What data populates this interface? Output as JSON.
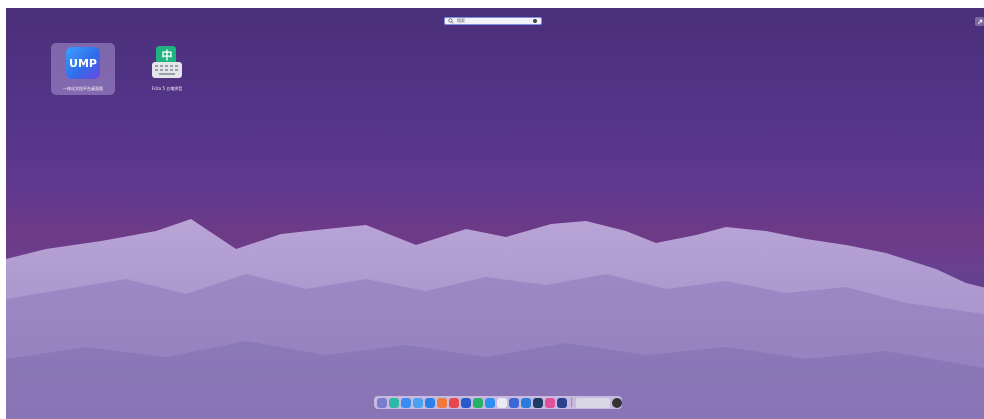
{
  "search": {
    "placeholder": "搜索",
    "value": ""
  },
  "desktop_icons": [
    {
      "label": "一体化文档平台桌面版",
      "tile_text": "UMP",
      "selected": true
    },
    {
      "label": "Fcitx 5 五笔拼音",
      "tile_text": "中",
      "selected": false
    }
  ],
  "dock": {
    "apps": [
      {
        "name": "launcher-icon",
        "color": "#7c7ccf"
      },
      {
        "name": "file-manager-icon",
        "color": "#2fb7a8"
      },
      {
        "name": "app-store-icon",
        "color": "#3a8cf0"
      },
      {
        "name": "mail-icon",
        "color": "#4aa3f2"
      },
      {
        "name": "browser-icon",
        "color": "#2c7ee8"
      },
      {
        "name": "music-icon",
        "color": "#f07a3c"
      },
      {
        "name": "terminal-icon",
        "color": "#e9474f"
      },
      {
        "name": "editor-icon",
        "color": "#2a59c9"
      },
      {
        "name": "image-viewer-icon",
        "color": "#29b06a"
      },
      {
        "name": "document-icon",
        "color": "#2e8ef2"
      },
      {
        "name": "calendar-icon",
        "color": "#eaeaf2"
      },
      {
        "name": "settings-icon",
        "color": "#3d67d6"
      },
      {
        "name": "monitor-icon",
        "color": "#2b7bd8"
      },
      {
        "name": "steam-icon",
        "color": "#1f3a66"
      },
      {
        "name": "notes-icon",
        "color": "#e34f9a"
      },
      {
        "name": "download-icon",
        "color": "#2d3f8f"
      }
    ],
    "tray": [
      {
        "name": "system-tray-icon",
        "color": "#d9d6e6"
      },
      {
        "name": "power-icon",
        "color": "#333333"
      }
    ]
  }
}
